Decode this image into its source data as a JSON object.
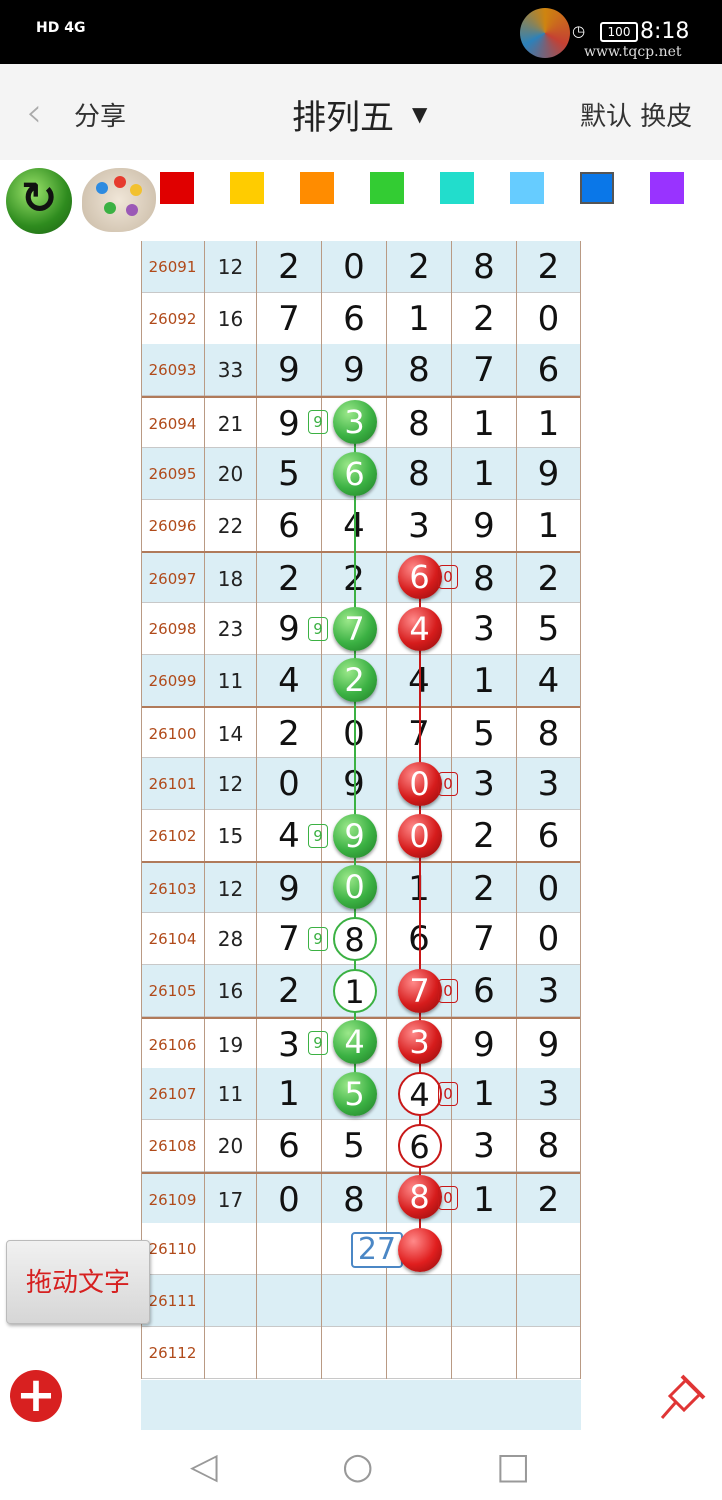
{
  "status": {
    "left": "HD 4G",
    "battery": "100",
    "time": "8:18",
    "watermark": "www.tqcp.net"
  },
  "header": {
    "back_icon": "chevron-left-icon",
    "share": "分享",
    "title": "排列五",
    "default_label": "默认",
    "skin_label": "换皮"
  },
  "toolbar": {
    "swatches": [
      "#e00000",
      "#ffcc00",
      "#ff8c00",
      "#33cc33",
      "#22ddcc",
      "#66ccff",
      "#0a77e8",
      "#9933ff"
    ]
  },
  "rows": [
    {
      "issue": "26091",
      "sum": "12",
      "d": [
        "2",
        "0",
        "2",
        "8",
        "2"
      ]
    },
    {
      "issue": "26092",
      "sum": "16",
      "d": [
        "7",
        "6",
        "1",
        "2",
        "0"
      ]
    },
    {
      "issue": "26093",
      "sum": "33",
      "d": [
        "9",
        "9",
        "8",
        "7",
        "6"
      ]
    },
    {
      "issue": "26094",
      "sum": "21",
      "d": [
        "9",
        "3",
        "8",
        "1",
        "1"
      ]
    },
    {
      "issue": "26095",
      "sum": "20",
      "d": [
        "5",
        "6",
        "8",
        "1",
        "9"
      ]
    },
    {
      "issue": "26096",
      "sum": "22",
      "d": [
        "6",
        "4",
        "3",
        "9",
        "1"
      ]
    },
    {
      "issue": "26097",
      "sum": "18",
      "d": [
        "2",
        "2",
        "6",
        "8",
        "2"
      ]
    },
    {
      "issue": "26098",
      "sum": "23",
      "d": [
        "9",
        "7",
        "4",
        "3",
        "5"
      ]
    },
    {
      "issue": "26099",
      "sum": "11",
      "d": [
        "4",
        "2",
        "4",
        "1",
        "4"
      ]
    },
    {
      "issue": "26100",
      "sum": "14",
      "d": [
        "2",
        "0",
        "7",
        "5",
        "8"
      ]
    },
    {
      "issue": "26101",
      "sum": "12",
      "d": [
        "0",
        "9",
        "0",
        "3",
        "3"
      ]
    },
    {
      "issue": "26102",
      "sum": "15",
      "d": [
        "4",
        "9",
        "0",
        "2",
        "6"
      ]
    },
    {
      "issue": "26103",
      "sum": "12",
      "d": [
        "9",
        "0",
        "1",
        "2",
        "0"
      ]
    },
    {
      "issue": "26104",
      "sum": "28",
      "d": [
        "7",
        "8",
        "6",
        "7",
        "0"
      ]
    },
    {
      "issue": "26105",
      "sum": "16",
      "d": [
        "2",
        "1",
        "7",
        "6",
        "3"
      ]
    },
    {
      "issue": "26106",
      "sum": "19",
      "d": [
        "3",
        "4",
        "3",
        "9",
        "9"
      ]
    },
    {
      "issue": "26107",
      "sum": "11",
      "d": [
        "1",
        "5",
        "4",
        "1",
        "3"
      ]
    },
    {
      "issue": "26108",
      "sum": "20",
      "d": [
        "6",
        "5",
        "6",
        "3",
        "8"
      ]
    },
    {
      "issue": "26109",
      "sum": "17",
      "d": [
        "0",
        "8",
        "8",
        "1",
        "2"
      ]
    },
    {
      "issue": "26110",
      "sum": "",
      "d": [
        "",
        "",
        "",
        "",
        ""
      ]
    },
    {
      "issue": "26111",
      "sum": "",
      "d": [
        "",
        "",
        "",
        "",
        ""
      ]
    },
    {
      "issue": "26112",
      "sum": "",
      "d": [
        "",
        "",
        "",
        "",
        ""
      ]
    }
  ],
  "marks": [
    {
      "row": 3,
      "col": 1,
      "style": "ball",
      "color": "green"
    },
    {
      "row": 4,
      "col": 1,
      "style": "ball",
      "color": "green"
    },
    {
      "row": 6,
      "col": 2,
      "style": "ball",
      "color": "red"
    },
    {
      "row": 7,
      "col": 1,
      "style": "ball",
      "color": "green"
    },
    {
      "row": 7,
      "col": 2,
      "style": "ball",
      "color": "red"
    },
    {
      "row": 8,
      "col": 1,
      "style": "ball",
      "color": "green"
    },
    {
      "row": 10,
      "col": 2,
      "style": "ball",
      "color": "red"
    },
    {
      "row": 11,
      "col": 1,
      "style": "ball",
      "color": "green"
    },
    {
      "row": 11,
      "col": 2,
      "style": "ball",
      "color": "red"
    },
    {
      "row": 12,
      "col": 1,
      "style": "ball",
      "color": "green"
    },
    {
      "row": 13,
      "col": 1,
      "style": "ring",
      "color": "green"
    },
    {
      "row": 14,
      "col": 1,
      "style": "ring",
      "color": "green"
    },
    {
      "row": 14,
      "col": 2,
      "style": "ball",
      "color": "red"
    },
    {
      "row": 15,
      "col": 1,
      "style": "ball",
      "color": "green"
    },
    {
      "row": 15,
      "col": 2,
      "style": "ball",
      "color": "red"
    },
    {
      "row": 16,
      "col": 1,
      "style": "ball",
      "color": "green"
    },
    {
      "row": 16,
      "col": 2,
      "style": "ring",
      "color": "red"
    },
    {
      "row": 17,
      "col": 2,
      "style": "ring",
      "color": "red"
    },
    {
      "row": 18,
      "col": 2,
      "style": "ball",
      "color": "red"
    }
  ],
  "tags": [
    {
      "row": 3,
      "col": 0,
      "text": "9",
      "color": "green"
    },
    {
      "row": 6,
      "col": 2,
      "text": "0",
      "color": "red"
    },
    {
      "row": 7,
      "col": 0,
      "text": "9",
      "color": "green"
    },
    {
      "row": 10,
      "col": 2,
      "text": "0",
      "color": "red"
    },
    {
      "row": 11,
      "col": 0,
      "text": "9",
      "color": "green"
    },
    {
      "row": 13,
      "col": 0,
      "text": "9",
      "color": "green"
    },
    {
      "row": 14,
      "col": 2,
      "text": "0",
      "color": "red"
    },
    {
      "row": 15,
      "col": 0,
      "text": "9",
      "color": "green"
    },
    {
      "row": 16,
      "col": 2,
      "text": "0",
      "color": "red"
    },
    {
      "row": 18,
      "col": 2,
      "text": "0",
      "color": "red"
    }
  ],
  "prediction": {
    "number": "27"
  },
  "drag_text": "拖动文字",
  "nav_icons": [
    "back-triangle-icon",
    "home-circle-icon",
    "recent-square-icon"
  ]
}
